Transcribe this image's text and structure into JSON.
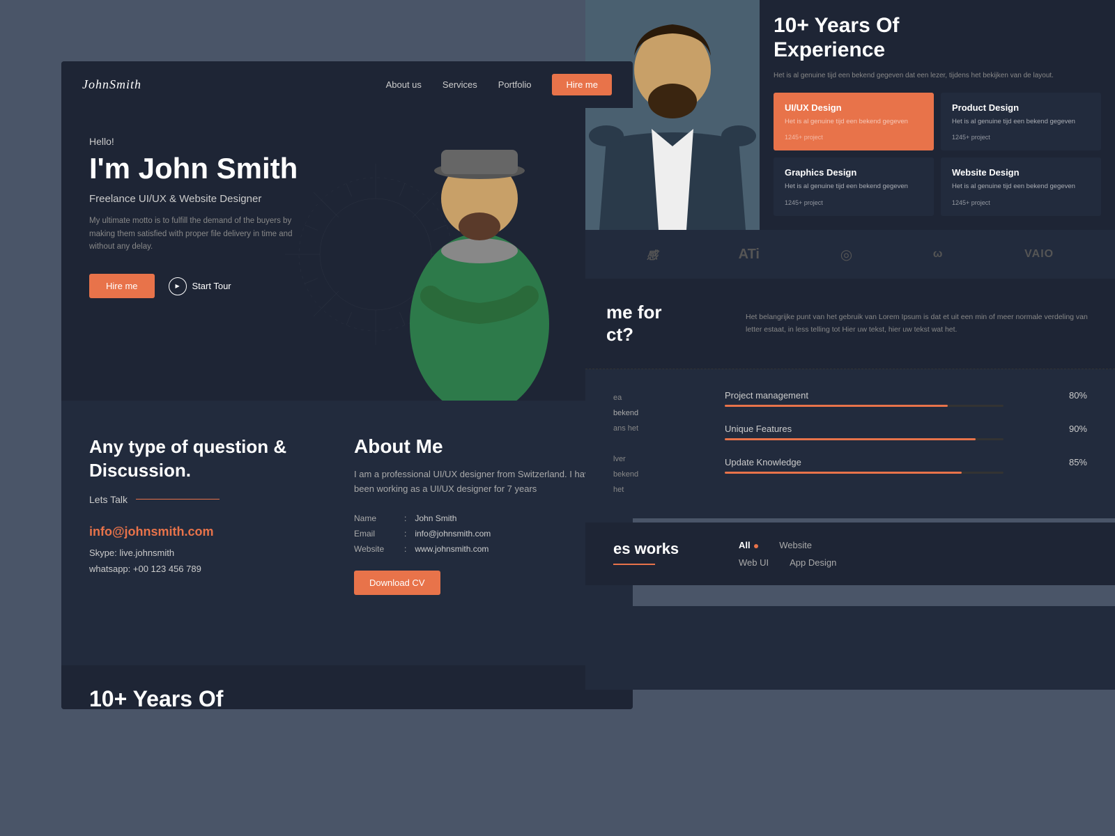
{
  "page": {
    "bg_color": "#4a5568"
  },
  "nav": {
    "logo": "JohnSmith",
    "links": [
      "About us",
      "Services",
      "Portfolio"
    ],
    "hire_btn": "Hire me"
  },
  "hero": {
    "greeting": "Hello!",
    "name": "I'm John Smith",
    "subtitle": "Freelance UI/UX & Website Designer",
    "description": "My ultimate motto is to fulfill the demand of the buyers by making them satisfied with proper file delivery in time and without any delay.",
    "hire_btn": "Hire me",
    "tour_btn": "Start Tour"
  },
  "experience": {
    "years_line1": "10+ Years Of",
    "years_line2": "Experience",
    "description": "Het is al genuine tijd een bekend gegeven dat een lezer, tijdens het bekijken van de layout."
  },
  "services": [
    {
      "title": "UI/UX Design",
      "description": "Het is al genuine tijd een bekend gegeven",
      "projects": "1245+ project",
      "highlighted": true
    },
    {
      "title": "Product Design",
      "description": "Het is al genuine tijd een bekend gegeven",
      "projects": "1245+ project",
      "highlighted": false
    },
    {
      "title": "Graphics Design",
      "description": "Het is al genuine tijd een bekend gegeven",
      "projects": "1245+ project",
      "highlighted": false
    },
    {
      "title": "Website Design",
      "description": "Het is al genuine tijd een bekend gegeven",
      "projects": "1245+ project",
      "highlighted": false
    }
  ],
  "brands": [
    "Alibaba",
    "ATi",
    "Target",
    "Last.fm",
    "VAIO"
  ],
  "hire_section": {
    "heading_part1": "me for",
    "heading_part2": "ct?",
    "description": "Het belangrijke punt van het gebruik van Lorem Ipsum is dat et uit een min of meer normale verdeling van letter estaat, in less telling tot Hier uw tekst, hier uw tekst wat het."
  },
  "skills": {
    "left_text": "ea\nbekend\nans het\nlver\nbekend\nhet",
    "items": [
      {
        "name": "Project management",
        "pct": 80
      },
      {
        "name": "Unique Features",
        "pct": 90
      },
      {
        "name": "Update Knowledge",
        "pct": 85
      }
    ]
  },
  "portfolio": {
    "filters": [
      "All",
      "Website",
      "Web UI",
      "App Design"
    ],
    "active_filter": "All",
    "heading": "es works"
  },
  "contact": {
    "heading": "Any type of question & Discussion.",
    "lets_talk": "Lets Talk",
    "email": "info@johnsmith.com",
    "skype": "Skype: live.johnsmith",
    "whatsapp": "whatsapp: +00 123 456 789"
  },
  "about_me": {
    "title": "About Me",
    "description": "I am a professional UI/UX designer from Switzerland. I have been working as a UI/UX designer for 7 years",
    "fields": [
      {
        "label": "Name",
        "value": "John Smith"
      },
      {
        "label": "Email",
        "value": "info@johnsmith.com"
      },
      {
        "label": "Website",
        "value": "www.johnsmith.com"
      }
    ],
    "download_btn": "Download CV"
  },
  "bottom_teaser": {
    "heading_line1": "10+ Years Of"
  }
}
